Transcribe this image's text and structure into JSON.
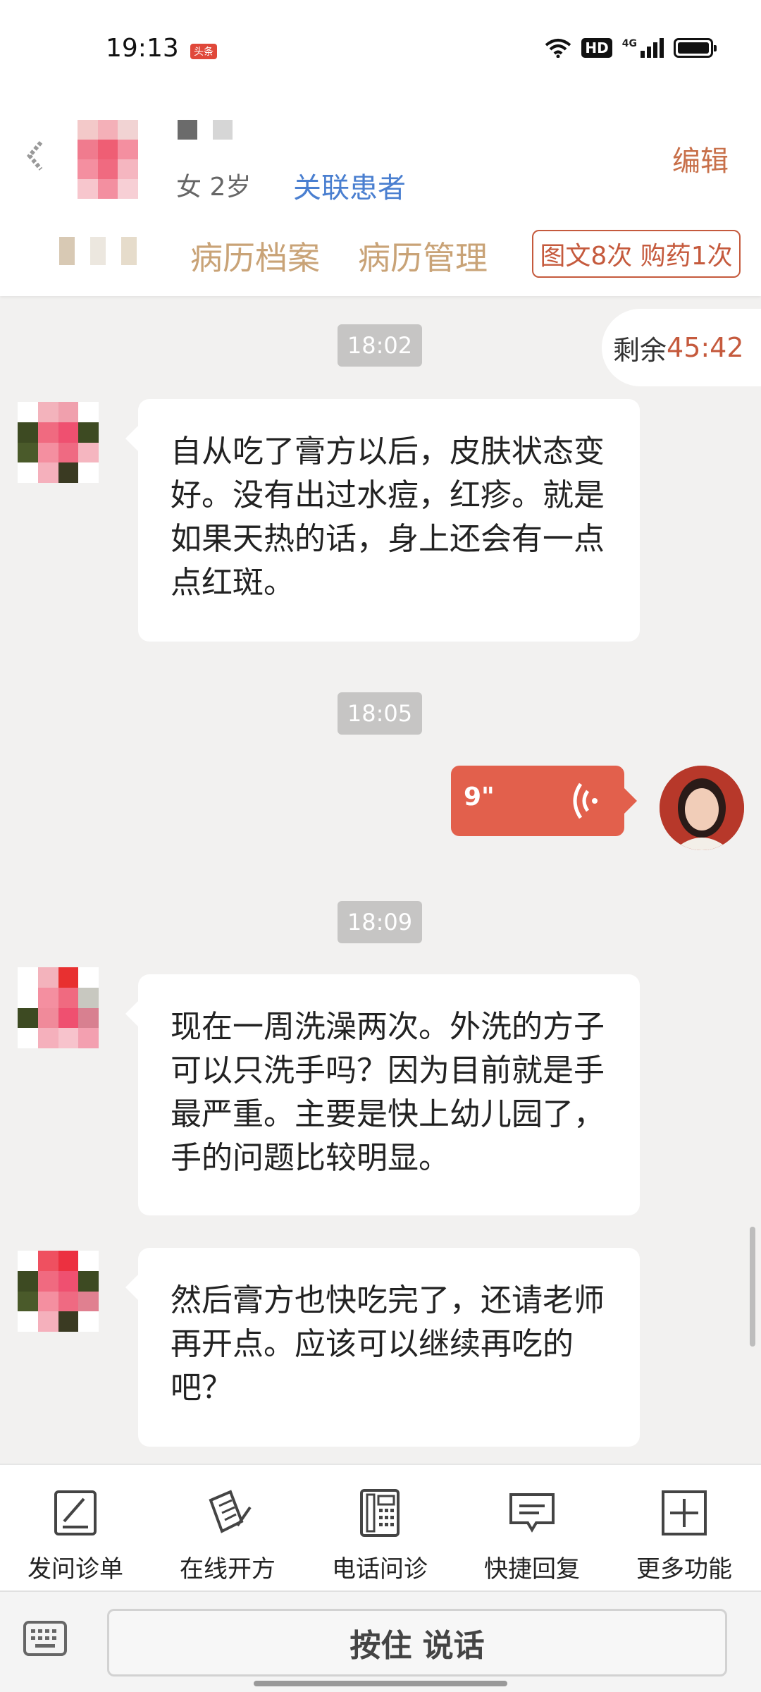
{
  "status_bar": {
    "time": "19:13",
    "badge": "头条",
    "hd": "HD",
    "network": "4G"
  },
  "header": {
    "patient_info": "女 2岁",
    "link_patient": "关联患者",
    "edit": "编辑",
    "tabs": [
      "病历档案",
      "病历管理"
    ],
    "stats_badge": "图文8次 购药1次"
  },
  "timer": {
    "label": "剩余",
    "value": "45:42"
  },
  "chat": {
    "time_1": "18:02",
    "msg_1": "自从吃了膏方以后，皮肤状态变好。没有出过水痘，红疹。就是如果天热的话，身上还会有一点点红斑。",
    "time_2": "18:05",
    "voice_duration": "9\"",
    "time_3": "18:09",
    "msg_2": "现在一周洗澡两次。外洗的方子可以只洗手吗？因为目前就是手最严重。主要是快上幼儿园了，手的问题比较明显。",
    "msg_3": "然后膏方也快吃完了，还请老师再开点。应该可以继续再吃的吧？"
  },
  "toolbar": {
    "items": [
      {
        "label": "发问诊单",
        "icon": "form-pen-icon"
      },
      {
        "label": "在线开方",
        "icon": "prescription-pen-icon"
      },
      {
        "label": "电话问诊",
        "icon": "phone-icon"
      },
      {
        "label": "快捷回复",
        "icon": "quick-reply-icon"
      },
      {
        "label": "更多功能",
        "icon": "plus-square-icon"
      }
    ]
  },
  "input": {
    "talk_button": "按住 说话"
  },
  "colors": {
    "accent": "#c55a3d",
    "voice_bubble": "#e2604c",
    "link": "#4a7fd0",
    "tab_text": "#c9a377"
  }
}
